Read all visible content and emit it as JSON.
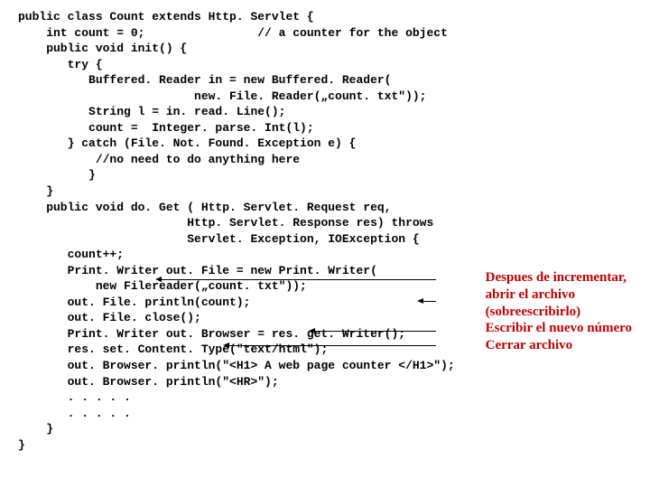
{
  "code": {
    "l01": "public class Count extends Http. Servlet {",
    "l02": "",
    "l03": "    int count = 0;                // a counter for the object",
    "l04": "",
    "l05": "    public void init() {",
    "l06": "       try {",
    "l07": "          Buffered. Reader in = new Buffered. Reader(",
    "l08": "                         new. File. Reader(„count. txt\"));",
    "l09": "          String l = in. read. Line();",
    "l10": "          count =  Integer. parse. Int(l);",
    "l11": "       } catch (File. Not. Found. Exception e) {",
    "l12": "           //no need to do anything here",
    "l13": "          }",
    "l14": "    }",
    "l15": "    public void do. Get ( Http. Servlet. Request req,",
    "l16": "                        Http. Servlet. Response res) throws",
    "l17": "                        Servlet. Exception, IOException {",
    "l18": "",
    "l19": "",
    "l20": "       count++;",
    "l21": "       Print. Writer out. File = new Print. Writer(",
    "l22": "           new Filereader(„count. txt\"));",
    "l23": "       out. File. println(count);",
    "l24": "       out. File. close();",
    "l25": "       Print. Writer out. Browser = res. get. Writer();",
    "l26": "       res. set. Content. Type(\"text/html\");",
    "l27": "       out. Browser. println(\"<H1> A web page counter </H1>\");",
    "l28": "       out. Browser. println(\"<HR>\");",
    "l29": "       . . . . .",
    "l30": "       . . . . .",
    "l31": "    }",
    "l32": "}"
  },
  "annotations": {
    "line1": "Despues de incrementar,",
    "line2": " abrir el archivo",
    "line3": "(sobreescribirlo)",
    "line4": "Escribir el nuevo número",
    "line5": "Cerrar archivo"
  }
}
